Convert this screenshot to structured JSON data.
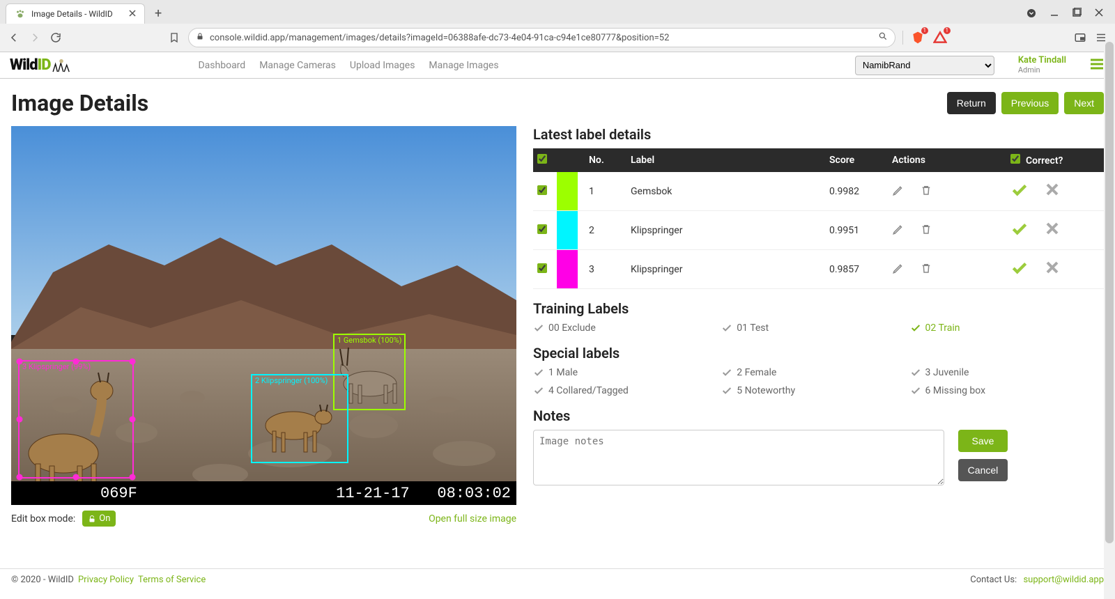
{
  "browser": {
    "tab_title": "Image Details - WildID",
    "url": "console.wildid.app/management/images/details?imageId=06388afe-dc73-4e04-91ca-c94e1ce80777&position=52"
  },
  "header": {
    "logo_wild": "Wild",
    "logo_id": "ID",
    "nav": {
      "dashboard": "Dashboard",
      "cameras": "Manage Cameras",
      "upload": "Upload Images",
      "manage": "Manage Images"
    },
    "project_selected": "NamibRand",
    "user_name": "Kate Tindall",
    "user_role": "Admin"
  },
  "page": {
    "title": "Image Details",
    "btn_return": "Return",
    "btn_prev": "Previous",
    "btn_next": "Next"
  },
  "image": {
    "timestamp_date": "11-21-17",
    "timestamp_time": "08:03:02",
    "temperature": "069F",
    "edit_mode_label": "Edit box mode:",
    "edit_mode_state": "On",
    "open_full": "Open full size image",
    "boxes": {
      "b1_tag": "1 Gemsbok (100%)",
      "b2_tag": "2 Klipspringer (100%)",
      "b3_tag": "3 Klipspringer (99%)"
    }
  },
  "labels": {
    "heading": "Latest label details",
    "cols": {
      "no": "No.",
      "label": "Label",
      "score": "Score",
      "actions": "Actions",
      "correct": "Correct?"
    },
    "rows": [
      {
        "no": "1",
        "label": "Gemsbok",
        "score": "0.9982",
        "color": "#9cff00"
      },
      {
        "no": "2",
        "label": "Klipspringer",
        "score": "0.9951",
        "color": "#00f5ff"
      },
      {
        "no": "3",
        "label": "Klipspringer",
        "score": "0.9857",
        "color": "#ff00e6"
      }
    ]
  },
  "training": {
    "heading": "Training Labels",
    "opts": {
      "exclude": "00 Exclude",
      "test": "01 Test",
      "train": "02 Train"
    }
  },
  "special": {
    "heading": "Special labels",
    "opts": {
      "o1": "1 Male",
      "o2": "2 Female",
      "o3": "3 Juvenile",
      "o4": "4 Collared/Tagged",
      "o5": "5 Noteworthy",
      "o6": "6 Missing box"
    }
  },
  "notes": {
    "heading": "Notes",
    "placeholder": "Image notes",
    "save": "Save",
    "cancel": "Cancel"
  },
  "footer": {
    "copyright": "© 2020 - WildID",
    "privacy": "Privacy Policy",
    "terms": "Terms of Service",
    "contact_label": "Contact Us:",
    "contact_email": "support@wildid.app"
  }
}
